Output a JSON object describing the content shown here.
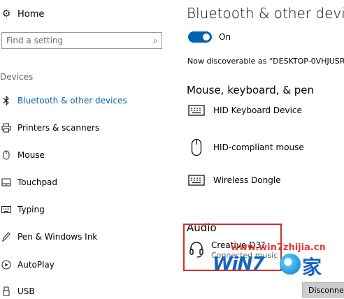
{
  "nav": {
    "home_label": "Home",
    "search_placeholder": "Find a setting",
    "section_header": "Devices",
    "items": [
      {
        "label": "Bluetooth & other devices",
        "icon": "bluetooth-icon",
        "active": true
      },
      {
        "label": "Printers & scanners",
        "icon": "printer-icon"
      },
      {
        "label": "Mouse",
        "icon": "mouse-icon"
      },
      {
        "label": "Touchpad",
        "icon": "touchpad-icon"
      },
      {
        "label": "Typing",
        "icon": "keyboard-icon"
      },
      {
        "label": "Pen & Windows Ink",
        "icon": "pen-icon"
      },
      {
        "label": "AutoPlay",
        "icon": "autoplay-icon"
      },
      {
        "label": "USB",
        "icon": "usb-icon"
      }
    ]
  },
  "main": {
    "title": "Bluetooth & other devic",
    "toggle_label": "On",
    "discoverable_text": "Now discoverable as “DESKTOP-0VHJUSR",
    "mouse_section_title": "Mouse, keyboard, & pen",
    "devices": [
      {
        "name": "HID Keyboard Device",
        "icon": "keyboard-icon"
      },
      {
        "name": "HID-compliant mouse",
        "icon": "mouse-icon"
      },
      {
        "name": "Wireless Dongle",
        "icon": "keyboard-icon"
      }
    ],
    "audio_section_title": "Audio",
    "audio_device": {
      "name": "Creative D3?",
      "status": "Connected music",
      "icon": "headset-icon"
    },
    "disconnect_label": "Disconnect"
  },
  "watermark": {
    "url": "www.win7zhijia.cn",
    "logo_text": "WiN7",
    "logo_char": "家"
  },
  "colors": {
    "accent": "#0063b1",
    "highlight": "#d32f2f",
    "watermark_red": "#e53935",
    "watermark_blue": "#1565c0"
  }
}
